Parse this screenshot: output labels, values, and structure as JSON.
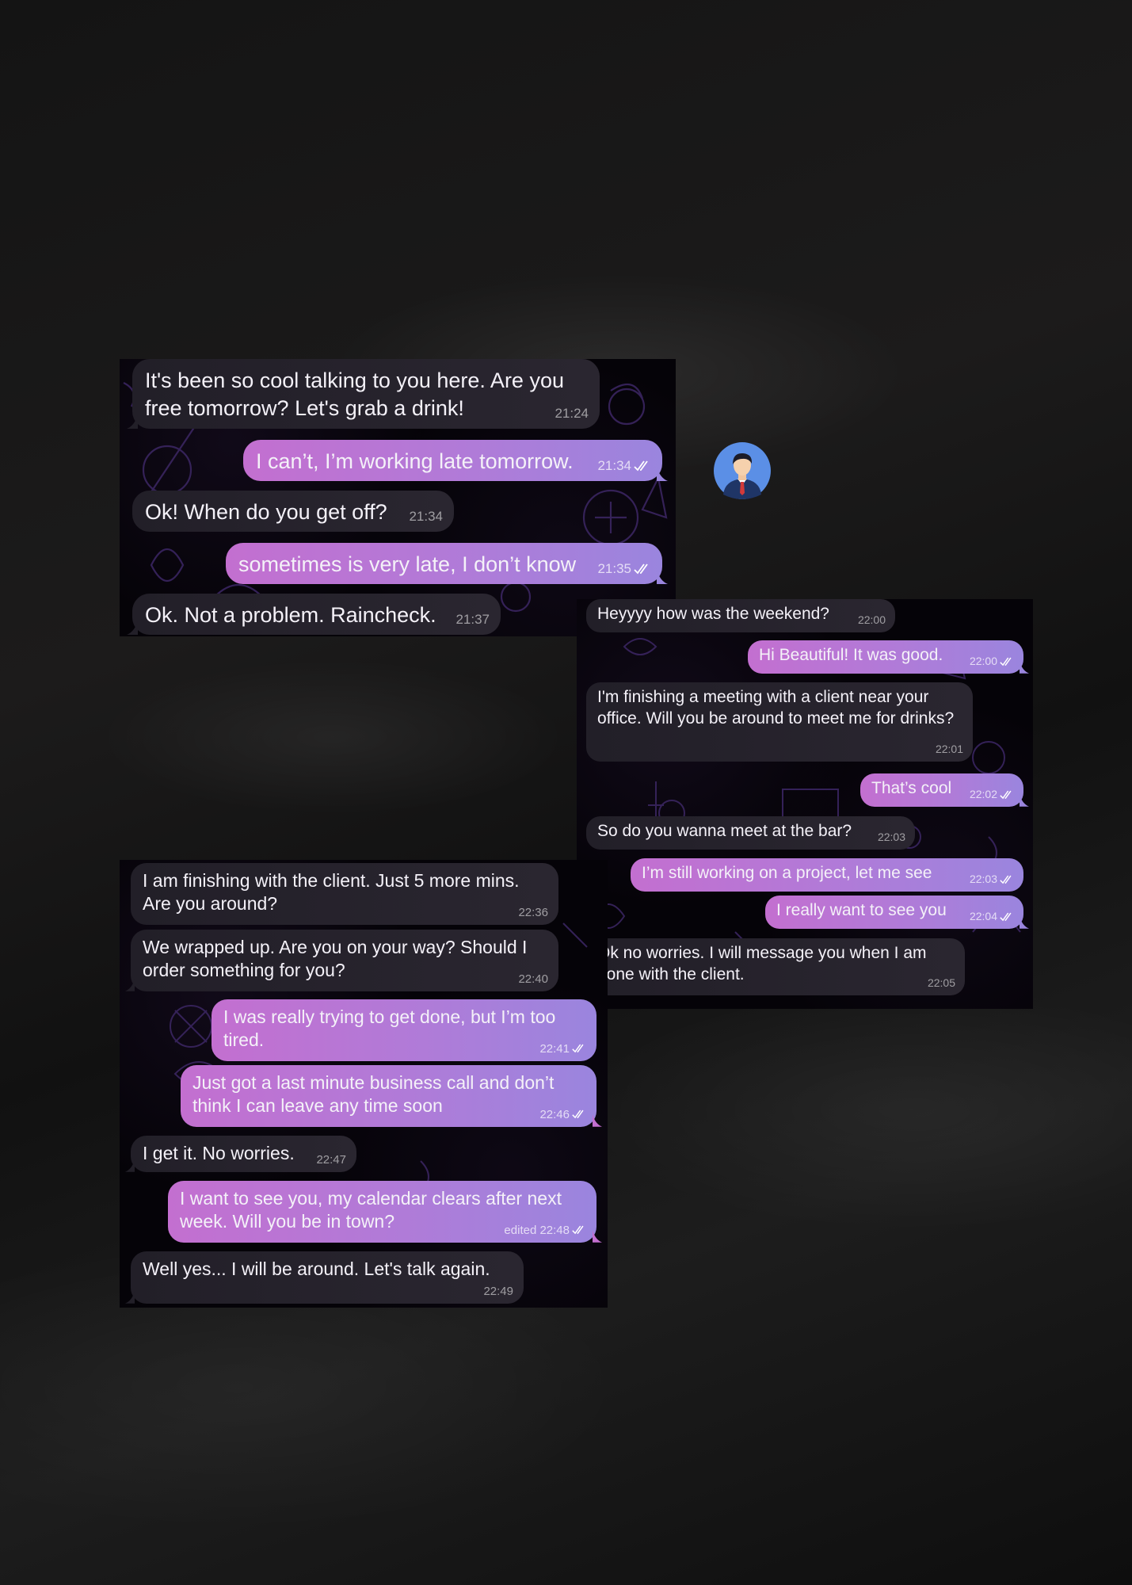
{
  "colors": {
    "incoming_bubble": "#26232c",
    "outgoing_bubble_start": "#c36fd0",
    "outgoing_bubble_end": "#9a85de",
    "chat_background": "#050308"
  },
  "avatar": {
    "icon": "businessman-avatar-icon"
  },
  "chat1": {
    "messages": [
      {
        "text": "It's been so cool talking to you here. Are you free tomorrow? Let's grab a drink!",
        "time": "21:24",
        "dir": "in"
      },
      {
        "text": "I can’t, I’m working late tomorrow.",
        "time": "21:34",
        "dir": "out",
        "status": "read-double-check"
      },
      {
        "text": "Ok! When do you get off?",
        "time": "21:34",
        "dir": "in"
      },
      {
        "text": "sometimes is very late, I don’t know",
        "time": "21:35",
        "dir": "out",
        "status": "read-double-check"
      },
      {
        "text": "Ok. Not a problem. Raincheck.",
        "time": "21:37",
        "dir": "in"
      }
    ]
  },
  "chat2": {
    "messages": [
      {
        "text": "Heyyyy how was the weekend?",
        "time": "22:00",
        "dir": "in"
      },
      {
        "text": "Hi Beautiful! It was good.",
        "time": "22:00",
        "dir": "out",
        "status": "read-double-check"
      },
      {
        "text": "I'm finishing a meeting with a client near your office. Will you be around to meet me for drinks?",
        "time": "22:01",
        "dir": "in"
      },
      {
        "text": "That’s cool",
        "time": "22:02",
        "dir": "out",
        "status": "read-double-check"
      },
      {
        "text": "So do you wanna meet at the bar?",
        "time": "22:03",
        "dir": "in"
      },
      {
        "text": "I’m still working on a project, let me see",
        "time": "22:03",
        "dir": "out",
        "status": "read-double-check"
      },
      {
        "text": "I really want to see you",
        "time": "22:04",
        "dir": "out",
        "status": "read-double-check"
      },
      {
        "text": "Ok no worries. I will message you when I am done with the client.",
        "time": "22:05",
        "dir": "in"
      }
    ]
  },
  "chat3": {
    "messages": [
      {
        "text": "I am finishing with the client. Just 5 more mins. Are you around?",
        "time": "22:36",
        "dir": "in"
      },
      {
        "text": "We wrapped up. Are you on your way? Should I order something for you?",
        "time": "22:40",
        "dir": "in"
      },
      {
        "text": "I was really trying to get done, but I’m too tired.",
        "time": "22:41",
        "dir": "out",
        "status": "read-double-check"
      },
      {
        "text": "Just got a last minute business call and don’t think I can leave any time soon",
        "time": "22:46",
        "dir": "out",
        "status": "read-double-check"
      },
      {
        "text": "I get it. No worries.",
        "time": "22:47",
        "dir": "in"
      },
      {
        "text": "I want to see you, my calendar clears after next week. Will you be in town?",
        "time": "edited 22:48",
        "dir": "out",
        "status": "read-double-check"
      },
      {
        "text": "Well yes... I will be around. Let's talk again.",
        "time": "22:49",
        "dir": "in"
      }
    ]
  }
}
